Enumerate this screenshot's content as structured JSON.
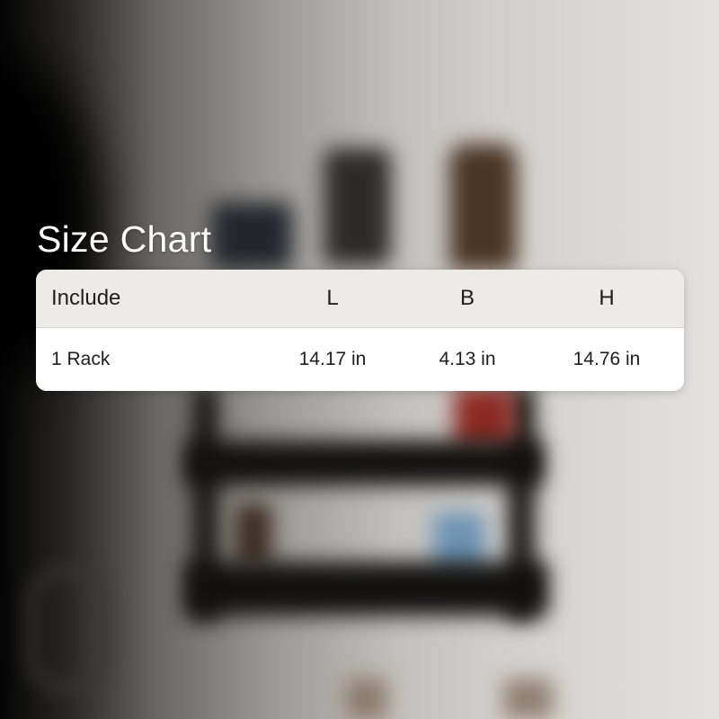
{
  "title": "Size Chart",
  "table": {
    "headers": [
      "Include",
      "L",
      "B",
      "H"
    ],
    "rows": [
      [
        "1 Rack",
        "14.17 in",
        "4.13 in",
        "14.76 in"
      ]
    ]
  },
  "colors": {
    "header_bg": "#ecebe7",
    "card_bg": "#ffffff",
    "title_text": "#ffffff",
    "cell_text": "#1e1e1e"
  }
}
